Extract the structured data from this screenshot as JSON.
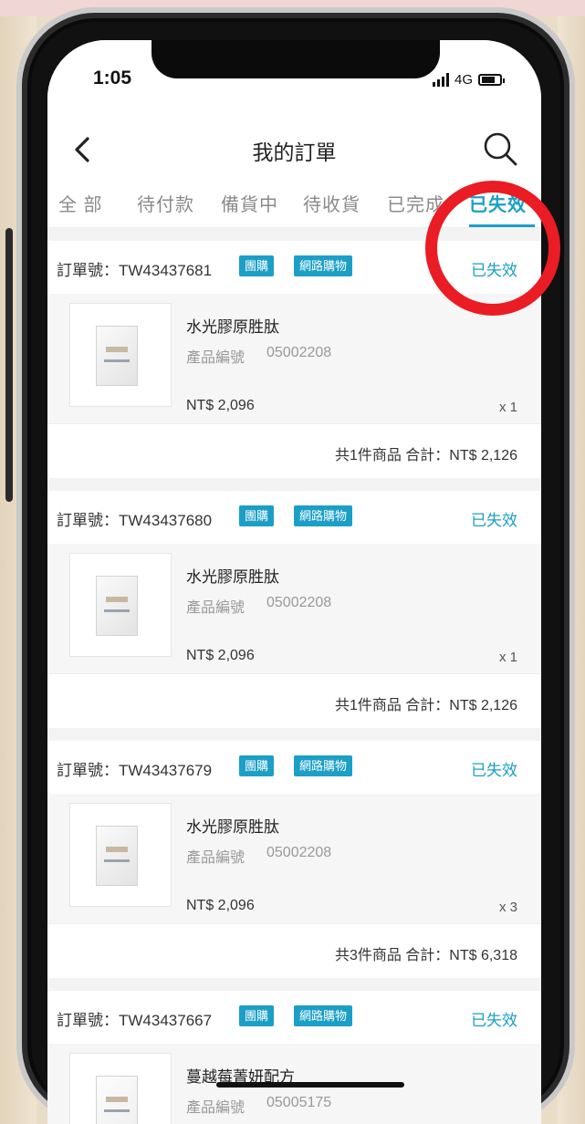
{
  "status_bar": {
    "time": "1:05",
    "network": "4G"
  },
  "header": {
    "title": "我的訂單"
  },
  "tabs": [
    {
      "label": "全 部",
      "active": false
    },
    {
      "label": "待付款",
      "active": false
    },
    {
      "label": "備貨中",
      "active": false
    },
    {
      "label": "待收貨",
      "active": false
    },
    {
      "label": "已完成",
      "active": false
    },
    {
      "label": "已失效",
      "active": true
    }
  ],
  "orders": [
    {
      "order_no": "訂單號：TW43437681",
      "badges": [
        "團購",
        "網路購物"
      ],
      "status": "已失效",
      "product_name": "水光膠原胜肽",
      "code_label": "產品編號",
      "code": "05002208",
      "price": "NT$ 2,096",
      "qty": "x 1",
      "summary": "共1件商品 合計：NT$ 2,126"
    },
    {
      "order_no": "訂單號：TW43437680",
      "badges": [
        "團購",
        "網路購物"
      ],
      "status": "已失效",
      "product_name": "水光膠原胜肽",
      "code_label": "產品編號",
      "code": "05002208",
      "price": "NT$ 2,096",
      "qty": "x 1",
      "summary": "共1件商品 合計：NT$ 2,126"
    },
    {
      "order_no": "訂單號：TW43437679",
      "badges": [
        "團購",
        "網路購物"
      ],
      "status": "已失效",
      "product_name": "水光膠原胜肽",
      "code_label": "產品編號",
      "code": "05002208",
      "price": "NT$ 2,096",
      "qty": "x 3",
      "summary": "共3件商品 合計：NT$ 6,318"
    },
    {
      "order_no": "訂單號：TW43437667",
      "badges": [
        "團購",
        "網路購物"
      ],
      "status": "已失效",
      "product_name": "蔓越莓菁妍配方",
      "code_label": "產品編號",
      "code": "05005175"
    }
  ],
  "colors": {
    "accent": "#1b9fc6",
    "highlight_circle": "#ea1c24"
  }
}
